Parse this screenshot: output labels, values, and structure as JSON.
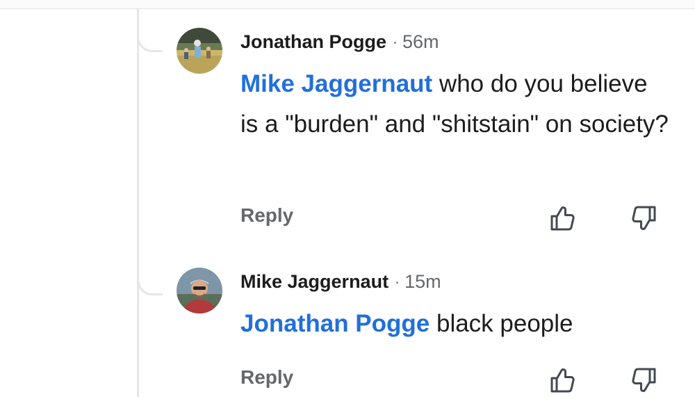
{
  "comments": [
    {
      "author": "Jonathan Pogge",
      "separator": "·",
      "time": "56m",
      "mention": "Mike Jaggernaut",
      "text": " who do you believe is a \"burden\" and \"shitstain\" on society?",
      "reply_label": "Reply",
      "avatar_icon": "profile-photo-outdoor",
      "upvote_icon": "thumbs-up-icon",
      "downvote_icon": "thumbs-down-icon"
    },
    {
      "author": "Mike Jaggernaut",
      "separator": "·",
      "time": "15m",
      "mention": "Jonathan Pogge",
      "text": " black people",
      "reply_label": "Reply",
      "avatar_icon": "profile-photo-person",
      "upvote_icon": "thumbs-up-icon",
      "downvote_icon": "thumbs-down-icon"
    }
  ],
  "colors": {
    "mention": "#216fdb",
    "secondary_text": "#65676b",
    "thread_line": "#e4e6eb"
  }
}
